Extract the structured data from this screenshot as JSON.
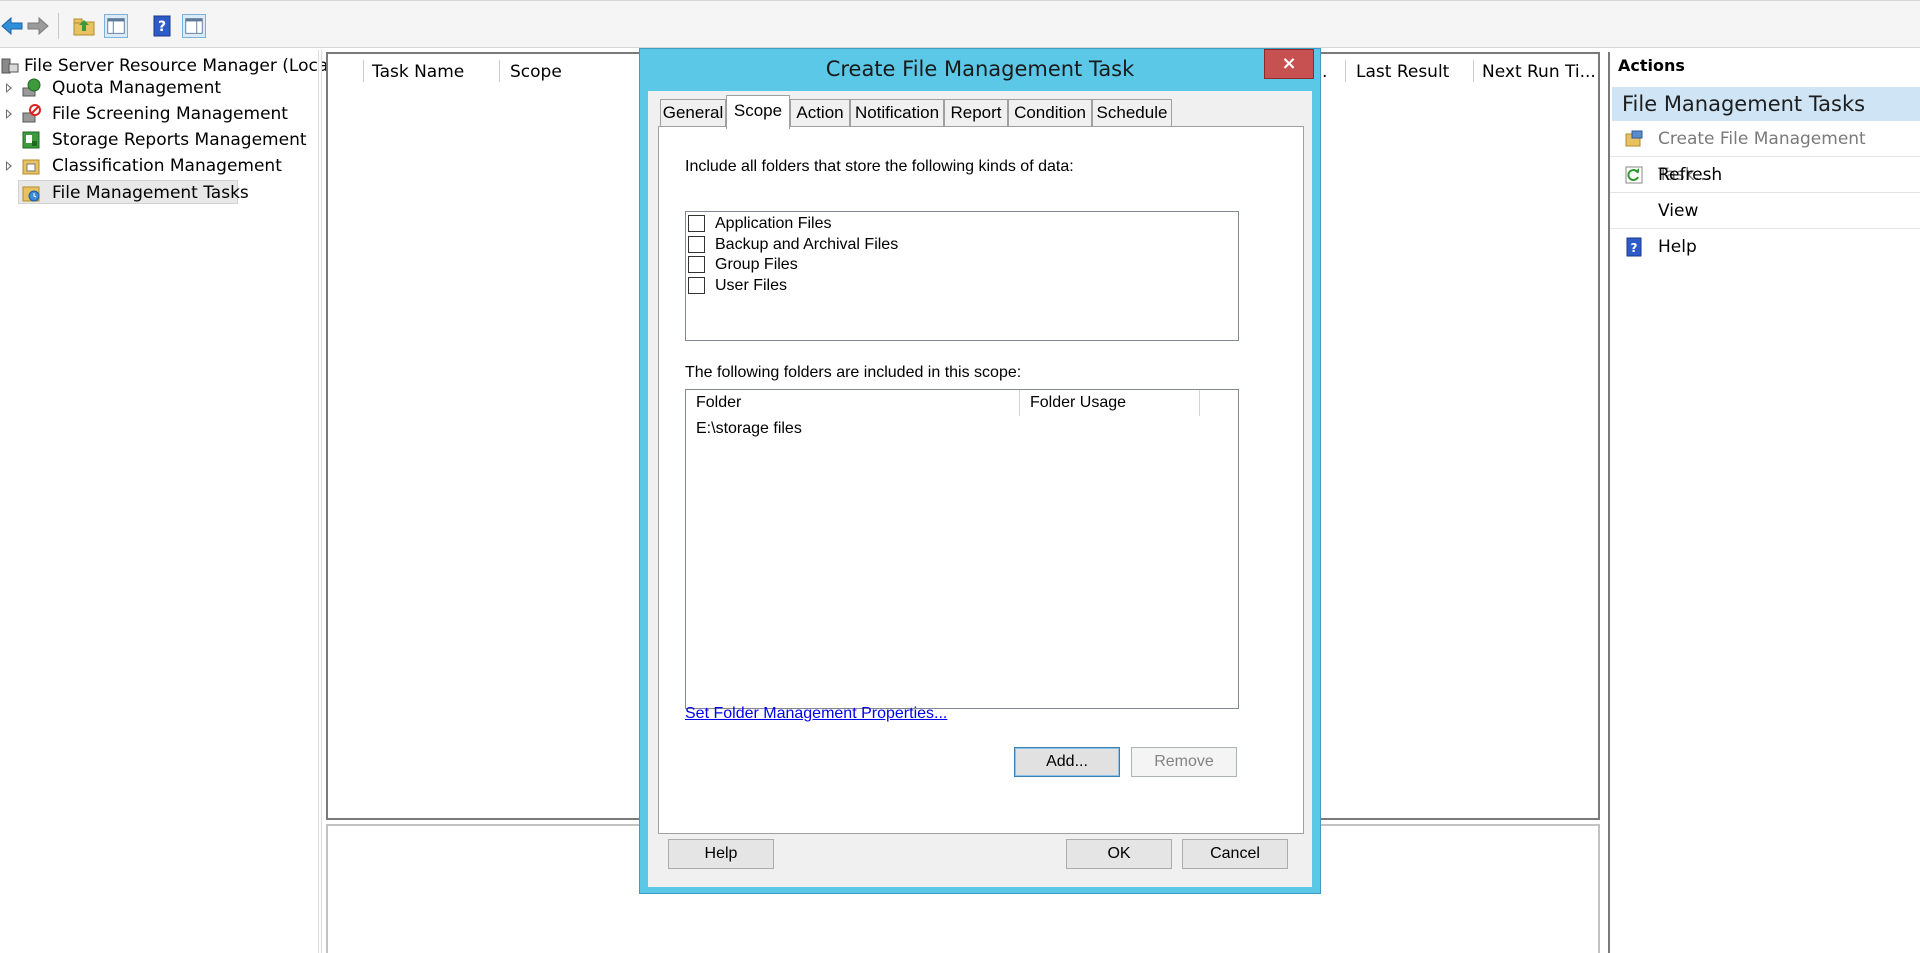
{
  "toolbar": {
    "icons": [
      "back-arrow-icon",
      "forward-arrow-icon",
      "up-folder-icon",
      "show-hide-console-tree-icon",
      "help-icon",
      "show-hide-action-pane-icon"
    ]
  },
  "tree": {
    "root": "File Server Resource Manager (Local)",
    "items": [
      {
        "label": "Quota Management",
        "expandable": true,
        "icon": "quota-icon"
      },
      {
        "label": "File Screening Management",
        "expandable": true,
        "icon": "file-screen-icon"
      },
      {
        "label": "Storage Reports Management",
        "expandable": false,
        "icon": "storage-report-icon"
      },
      {
        "label": "Classification Management",
        "expandable": true,
        "icon": "classification-icon"
      },
      {
        "label": "File Management Tasks",
        "expandable": false,
        "icon": "file-task-icon",
        "selected": true
      }
    ]
  },
  "list": {
    "columns": [
      "Task Name",
      "Scope",
      ".",
      "Last Result",
      "Next Run Ti..."
    ]
  },
  "actions": {
    "title": "Actions",
    "section": "File Management Tasks",
    "items": [
      {
        "label": "Create File Management Task...",
        "icon": "create-task-icon",
        "enabled": false
      },
      {
        "label": "Refresh",
        "icon": "refresh-icon",
        "enabled": true
      },
      {
        "label": "View",
        "icon": "",
        "enabled": true
      },
      {
        "label": "Help",
        "icon": "help-icon",
        "enabled": true
      }
    ]
  },
  "dialog": {
    "title": "Create File Management Task",
    "close_label": "×",
    "tabs": [
      "General",
      "Scope",
      "Action",
      "Notification",
      "Report",
      "Condition",
      "Schedule"
    ],
    "active_tab": "Scope",
    "include_label": "Include all folders that store the following kinds of data:",
    "data_kinds": [
      {
        "label": "Application Files",
        "checked": false
      },
      {
        "label": "Backup and Archival Files",
        "checked": false
      },
      {
        "label": "Group Files",
        "checked": false
      },
      {
        "label": "User Files",
        "checked": false
      }
    ],
    "folders_label": "The following folders are included in this scope:",
    "folder_columns": [
      "Folder",
      "Folder Usage"
    ],
    "folders": [
      {
        "folder": "E:\\storage files",
        "usage": ""
      }
    ],
    "link": "Set Folder Management Properties...",
    "add_label": "Add...",
    "remove_label": "Remove",
    "help_label": "Help",
    "ok_label": "OK",
    "cancel_label": "Cancel"
  }
}
